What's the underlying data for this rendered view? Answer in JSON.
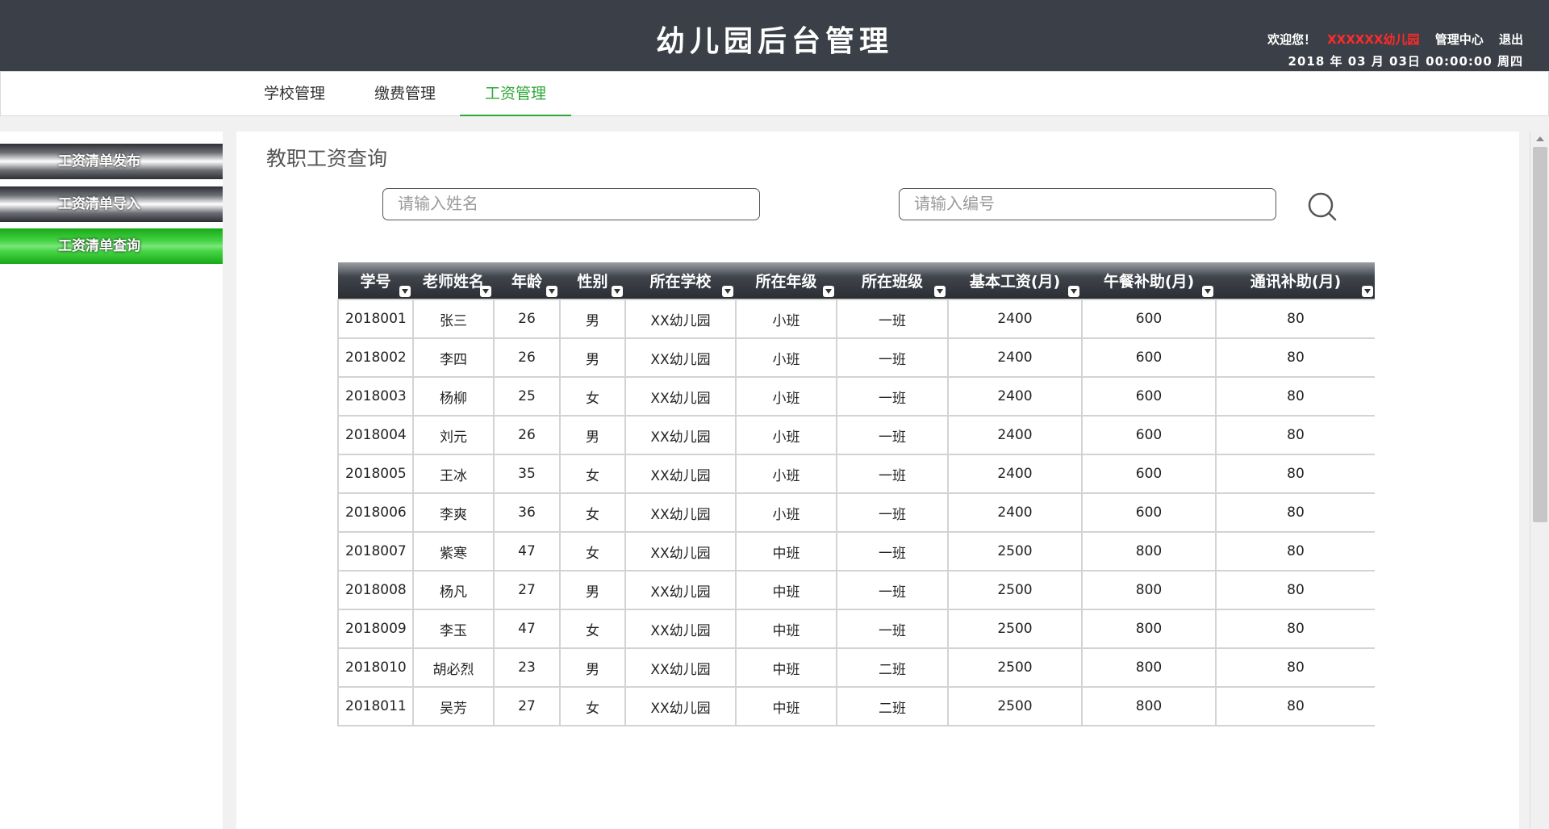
{
  "header": {
    "title": "幼儿园后台管理",
    "welcome": "欢迎您！",
    "school_name": "XXXXXX幼儿园",
    "admin_center": "管理中心",
    "logout": "退出",
    "datetime": "2018 年 03 月 03日 00:00:00 周四"
  },
  "topnav": {
    "tabs": [
      {
        "label": "学校管理"
      },
      {
        "label": "缴费管理"
      },
      {
        "label": "工资管理"
      }
    ],
    "active": "工资管理"
  },
  "sidebar": {
    "items": [
      {
        "label": "工资清单发布"
      },
      {
        "label": "工资清单导入"
      },
      {
        "label": "工资清单查询"
      }
    ],
    "active": "工资清单查询"
  },
  "main": {
    "title": "教职工资查询",
    "search_name": {
      "placeholder": "请输入姓名",
      "value": ""
    },
    "search_id": {
      "placeholder": "请输入编号",
      "value": ""
    },
    "search_icon": "search-icon"
  },
  "table": {
    "columns": [
      "学号",
      "老师姓名",
      "年龄",
      "性别",
      "所在学校",
      "所在年级",
      "所在班级",
      "基本工资(月)",
      "午餐补助(月)",
      "通讯补助(月)"
    ],
    "rows": [
      [
        "2018001",
        "张三",
        "26",
        "男",
        "XX幼儿园",
        "小班",
        "一班",
        "2400",
        "600",
        "80"
      ],
      [
        "2018002",
        "李四",
        "26",
        "男",
        "XX幼儿园",
        "小班",
        "一班",
        "2400",
        "600",
        "80"
      ],
      [
        "2018003",
        "杨柳",
        "25",
        "女",
        "XX幼儿园",
        "小班",
        "一班",
        "2400",
        "600",
        "80"
      ],
      [
        "2018004",
        "刘元",
        "26",
        "男",
        "XX幼儿园",
        "小班",
        "一班",
        "2400",
        "600",
        "80"
      ],
      [
        "2018005",
        "王冰",
        "35",
        "女",
        "XX幼儿园",
        "小班",
        "一班",
        "2400",
        "600",
        "80"
      ],
      [
        "2018006",
        "李爽",
        "36",
        "女",
        "XX幼儿园",
        "小班",
        "一班",
        "2400",
        "600",
        "80"
      ],
      [
        "2018007",
        "紫寒",
        "47",
        "女",
        "XX幼儿园",
        "中班",
        "一班",
        "2500",
        "800",
        "80"
      ],
      [
        "2018008",
        "杨凡",
        "27",
        "男",
        "XX幼儿园",
        "中班",
        "一班",
        "2500",
        "800",
        "80"
      ],
      [
        "2018009",
        "李玉",
        "47",
        "女",
        "XX幼儿园",
        "中班",
        "一班",
        "2500",
        "800",
        "80"
      ],
      [
        "2018010",
        "胡必烈",
        "23",
        "男",
        "XX幼儿园",
        "中班",
        "二班",
        "2500",
        "800",
        "80"
      ],
      [
        "2018011",
        "吴芳",
        "27",
        "女",
        "XX幼儿园",
        "中班",
        "二班",
        "2500",
        "800",
        "80"
      ]
    ]
  },
  "colors": {
    "header_bg": "#3b3f47",
    "accent_green": "#2ea836",
    "school_red": "#ff2a2a"
  }
}
